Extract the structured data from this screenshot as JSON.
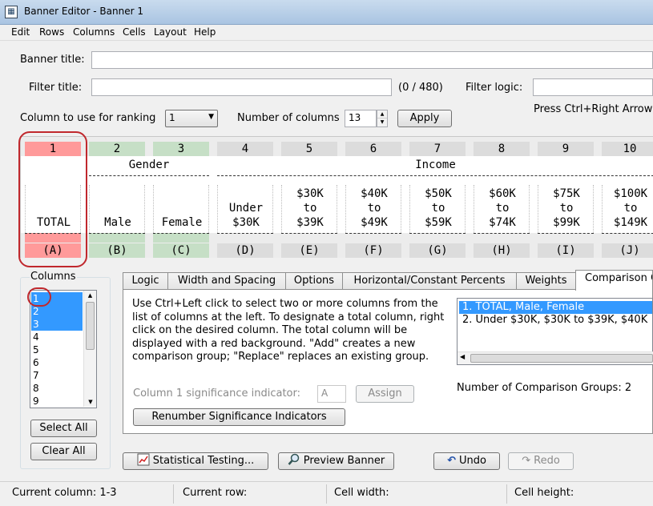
{
  "window": {
    "title": "Banner Editor - Banner 1",
    "app_icon": "banner-editor-icon"
  },
  "menu": [
    "Edit",
    "Rows",
    "Columns",
    "Cells",
    "Layout",
    "Help"
  ],
  "form": {
    "banner_title_label": "Banner title:",
    "banner_title_value": "",
    "filter_title_label": "Filter title:",
    "filter_title_value": "",
    "filter_count": "(0 / 480)",
    "filter_logic_label": "Filter logic:",
    "filter_logic_value": "",
    "ranking_label": "Column to use for ranking",
    "ranking_value": "1",
    "num_columns_label": "Number of columns",
    "num_columns_value": "13",
    "apply_label": "Apply",
    "hint": "Press Ctrl+Right Arrow"
  },
  "banner": {
    "columns": [
      {
        "num": "1",
        "line1": "",
        "line2": "",
        "line3": "TOTAL",
        "letter": "(A)",
        "color": "#ff9a9a"
      },
      {
        "num": "2",
        "line1": "",
        "line2": "",
        "line3": "Male",
        "letter": "(B)",
        "color": "#c6dfc6"
      },
      {
        "num": "3",
        "line1": "",
        "line2": "",
        "line3": "Female",
        "letter": "(C)",
        "color": "#c6dfc6"
      },
      {
        "num": "4",
        "line1": "",
        "line2": "Under",
        "line3": "$30K",
        "letter": "(D)",
        "color": "#dcdcdc"
      },
      {
        "num": "5",
        "line1": "$30K",
        "line2": "to",
        "line3": "$39K",
        "letter": "(E)",
        "color": "#dcdcdc"
      },
      {
        "num": "6",
        "line1": "$40K",
        "line2": "to",
        "line3": "$49K",
        "letter": "(F)",
        "color": "#dcdcdc"
      },
      {
        "num": "7",
        "line1": "$50K",
        "line2": "to",
        "line3": "$59K",
        "letter": "(G)",
        "color": "#dcdcdc"
      },
      {
        "num": "8",
        "line1": "$60K",
        "line2": "to",
        "line3": "$74K",
        "letter": "(H)",
        "color": "#dcdcdc"
      },
      {
        "num": "9",
        "line1": "$75K",
        "line2": "to",
        "line3": "$99K",
        "letter": "(I)",
        "color": "#dcdcdc"
      },
      {
        "num": "10",
        "line1": "$100K",
        "line2": "to",
        "line3": "$149K",
        "letter": "(J)",
        "color": "#dcdcdc"
      }
    ],
    "gender_label": "Gender",
    "income_label": "Income"
  },
  "columns_panel": {
    "title": "Columns",
    "items": [
      "1",
      "2",
      "3",
      "4",
      "5",
      "6",
      "7",
      "8",
      "9"
    ],
    "selected": [
      "1",
      "2",
      "3"
    ],
    "select_all": "Select All",
    "clear_all": "Clear All"
  },
  "tabs": [
    "Logic",
    "Width and Spacing",
    "Options",
    "Horizontal/Constant Percents",
    "Weights",
    "Comparison G"
  ],
  "active_tab": "Comparison G",
  "comparison": {
    "instructions": "Use Ctrl+Left click to select two or more columns from the list of columns at the left. To designate a total column, right click on the desired column. The total column will be displayed with a red background. \"Add\" creates a new comparison group; \"Replace\" replaces an existing group.",
    "groups": [
      "1. TOTAL, Male, Female",
      "2. Under $30K, $30K to $39K, $40K"
    ],
    "sig_label": "Column 1 significance indicator:",
    "sig_value": "A",
    "assign_label": "Assign",
    "renumber_label": "Renumber Significance Indicators",
    "count_label": "Number of Comparison Groups: 2"
  },
  "bottom": {
    "stat_testing": "Statistical Testing...",
    "preview": "Preview Banner",
    "undo": "Undo",
    "redo": "Redo"
  },
  "status": {
    "current_column": "Current column: 1-3",
    "current_row": "Current row:",
    "cell_width": "Cell width:",
    "cell_height": "Cell height:"
  },
  "colors": {
    "selection": "#3399ff",
    "annotation": "#c0282d",
    "total_column": "#ff9a9a",
    "comparison_column": "#c6dfc6"
  }
}
